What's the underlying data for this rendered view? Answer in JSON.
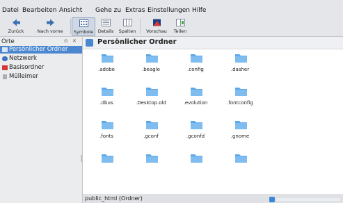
{
  "menubar": {
    "items": [
      {
        "label": "Datei",
        "name": "menu-datei"
      },
      {
        "label": "Bearbeiten",
        "name": "menu-bearbeiten"
      },
      {
        "label": "Ansicht",
        "name": "menu-ansicht"
      },
      {
        "label": "Gehe zu",
        "name": "menu-gehe-zu"
      },
      {
        "label": "Extras",
        "name": "menu-extras"
      },
      {
        "label": "Einstellungen",
        "name": "menu-einstellungen"
      },
      {
        "label": "Hilfe",
        "name": "menu-hilfe"
      }
    ]
  },
  "toolbar": {
    "back_label": "Zurück",
    "forward_label": "Nach vorne",
    "icons_label": "Symbole",
    "details_label": "Details",
    "columns_label": "Spalten",
    "preview_label": "Vorschau",
    "split_label": "Teilen"
  },
  "sidebar": {
    "header": "Orte",
    "pin_icon": "pin-icon",
    "close_icon": "close-icon",
    "items": [
      {
        "label": "Persönlicher Ordner",
        "icon": "home-icon",
        "selected": true
      },
      {
        "label": "Netzwerk",
        "icon": "network-icon",
        "selected": false
      },
      {
        "label": "Basisordner",
        "icon": "root-folder-icon",
        "selected": false
      },
      {
        "label": "Mülleimer",
        "icon": "trash-icon",
        "selected": false
      }
    ]
  },
  "main": {
    "title": "Persönlicher Ordner",
    "files": [
      ".adobe",
      ".beagle",
      ".config",
      ".dasher",
      ".dbus",
      ".Desktop.old",
      ".evolution",
      ".fontconfig",
      ".fonts",
      ".gconf",
      ".gconfd",
      ".gnome",
      "",
      "",
      "",
      ""
    ]
  },
  "statusbar": {
    "text": "public_html (Ordner)"
  },
  "colors": {
    "selection": "#4b87cf",
    "folder": "#5fa8e8"
  }
}
